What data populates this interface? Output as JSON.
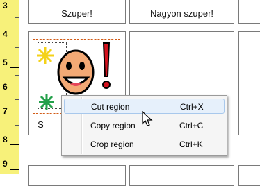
{
  "ruler": {
    "numbers": [
      "3",
      "4",
      "5",
      "6",
      "7",
      "8",
      "9"
    ]
  },
  "top_cells": {
    "cell1_label": "Szuper!",
    "cell2_label": "Nagyon szuper!"
  },
  "selected_cell": {
    "label": "S"
  },
  "context_menu": {
    "items": [
      {
        "label": "Cut region",
        "shortcut": "Ctrl+X"
      },
      {
        "label": "Copy region",
        "shortcut": "Ctrl+C"
      },
      {
        "label": "Crop region",
        "shortcut": "Ctrl+K"
      }
    ]
  },
  "colors": {
    "ruler_bg": "#f7f17a",
    "selection_border": "#d25b16",
    "menu_hover": "#e6f0fb"
  },
  "icons": [
    "cursor-arrow-icon",
    "star-yellow-icon",
    "star-green-icon",
    "smiley-face-icon",
    "exclamation-mark-icon"
  ]
}
